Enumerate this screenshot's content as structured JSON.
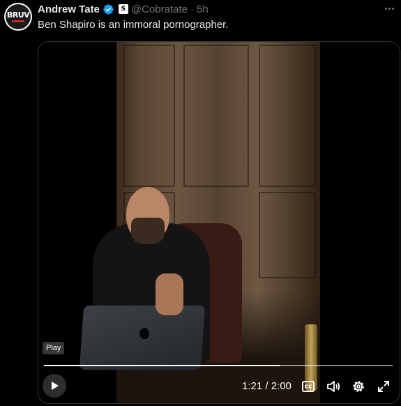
{
  "author": {
    "name": "Andrew Tate",
    "handle": "@Cobratate",
    "separator": "·",
    "timestamp": "5h",
    "avatar_text": "BRUV",
    "affiliation_badge": "$"
  },
  "tweet": {
    "text": "Ben Shapiro is an immoral pornographer."
  },
  "video": {
    "tooltip": "Play",
    "current_time": "1:21",
    "duration": "2:00",
    "time_display": "1:21 / 2:00",
    "progress": 0.675,
    "controls": [
      "play-icon",
      "captions-icon",
      "volume-icon",
      "settings-icon",
      "fullscreen-icon"
    ]
  },
  "colors": {
    "background": "#000000",
    "text": "#e7e9ea",
    "muted": "#71767b",
    "verified": "#1d9bf0",
    "border": "#2f3336"
  }
}
